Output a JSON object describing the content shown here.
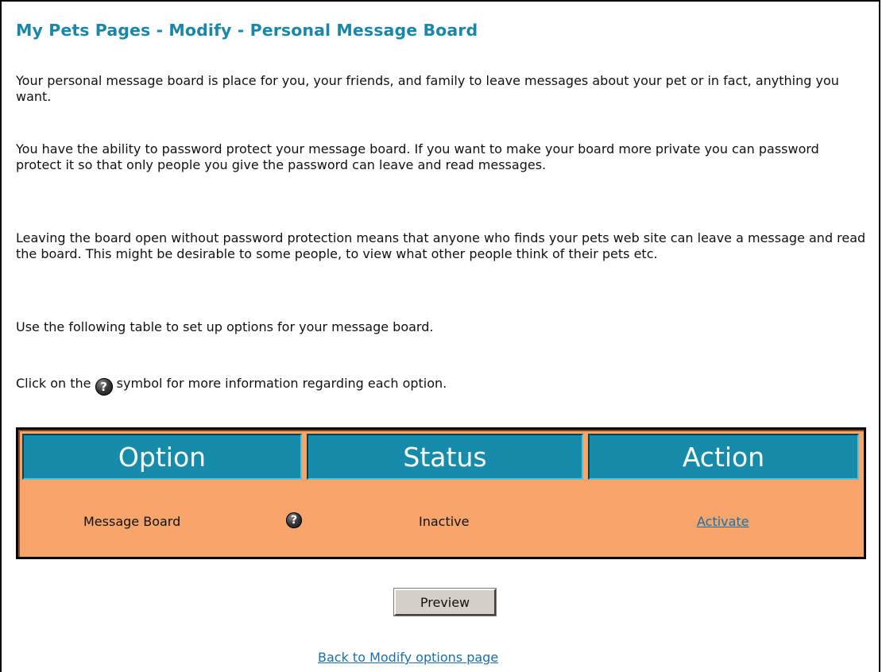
{
  "page": {
    "title": "My Pets Pages - Modify - Personal Message Board",
    "intro_paragraphs": [
      "Your personal message board is place for you, your friends, and family to leave messages about your pet or in fact, anything you want.",
      "You have the ability to password protect your message board. If you want to make your board more private you can password protect it so that only people you give the password can leave and read messages.",
      "Leaving the board open without password protection means that anyone who finds your pets web site can leave a message and read the board. This might be desirable to some people, to view what other people think of their pets etc.",
      "Use the following table to set up options for your message board."
    ],
    "help_line": {
      "before": "Click on the ",
      "after": " symbol for more information regarding each option.",
      "icon": "help-question-icon"
    }
  },
  "options_table": {
    "headers": [
      "Option",
      "Status",
      "Action"
    ],
    "rows": [
      {
        "option": "Message Board",
        "help_icon": "help-question-icon",
        "status": "Inactive",
        "action": "Activate"
      }
    ],
    "colors": {
      "header_bg": "#178caa",
      "row_bg": "#f8a56b",
      "border": "#000000"
    }
  },
  "buttons": {
    "preview_label": "Preview"
  },
  "links": {
    "back_label": "Back to Modify options page"
  },
  "colors": {
    "title": "#1a87a8",
    "link": "#1a6fa8"
  }
}
